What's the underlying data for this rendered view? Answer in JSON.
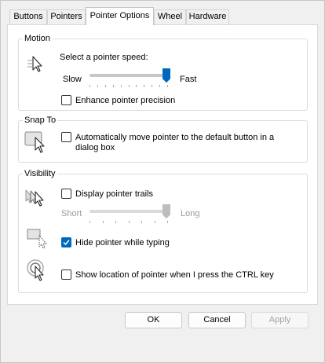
{
  "tabs": [
    {
      "label": "Buttons",
      "active": false
    },
    {
      "label": "Pointers",
      "active": false
    },
    {
      "label": "Pointer Options",
      "active": true
    },
    {
      "label": "Wheel",
      "active": false
    },
    {
      "label": "Hardware",
      "active": false
    }
  ],
  "motion": {
    "title": "Motion",
    "speed_label": "Select a pointer speed:",
    "slow_label": "Slow",
    "fast_label": "Fast",
    "speed_value": 1.0,
    "enhance_label": "Enhance pointer precision",
    "enhance_checked": false,
    "icon": "pointer-speed-icon"
  },
  "snap": {
    "title": "Snap To",
    "label_line1": "Automatically move pointer to the default button in a",
    "label_line2": "dialog box",
    "checked": false,
    "icon": "snap-to-icon"
  },
  "visibility": {
    "title": "Visibility",
    "trails_label": "Display pointer trails",
    "trails_checked": false,
    "short_label": "Short",
    "long_label": "Long",
    "trail_value": 1.0,
    "trails_icon": "pointer-trails-icon",
    "hide_label": "Hide pointer while typing",
    "hide_checked": true,
    "hide_icon": "hide-pointer-icon",
    "ctrl_label": "Show location of pointer when I press the CTRL key",
    "ctrl_checked": false,
    "ctrl_icon": "locate-pointer-icon"
  },
  "buttons": {
    "ok": "OK",
    "cancel": "Cancel",
    "apply": "Apply",
    "apply_enabled": false
  },
  "colors": {
    "accent": "#0067c0",
    "disabled_text": "#9a9a9a"
  }
}
